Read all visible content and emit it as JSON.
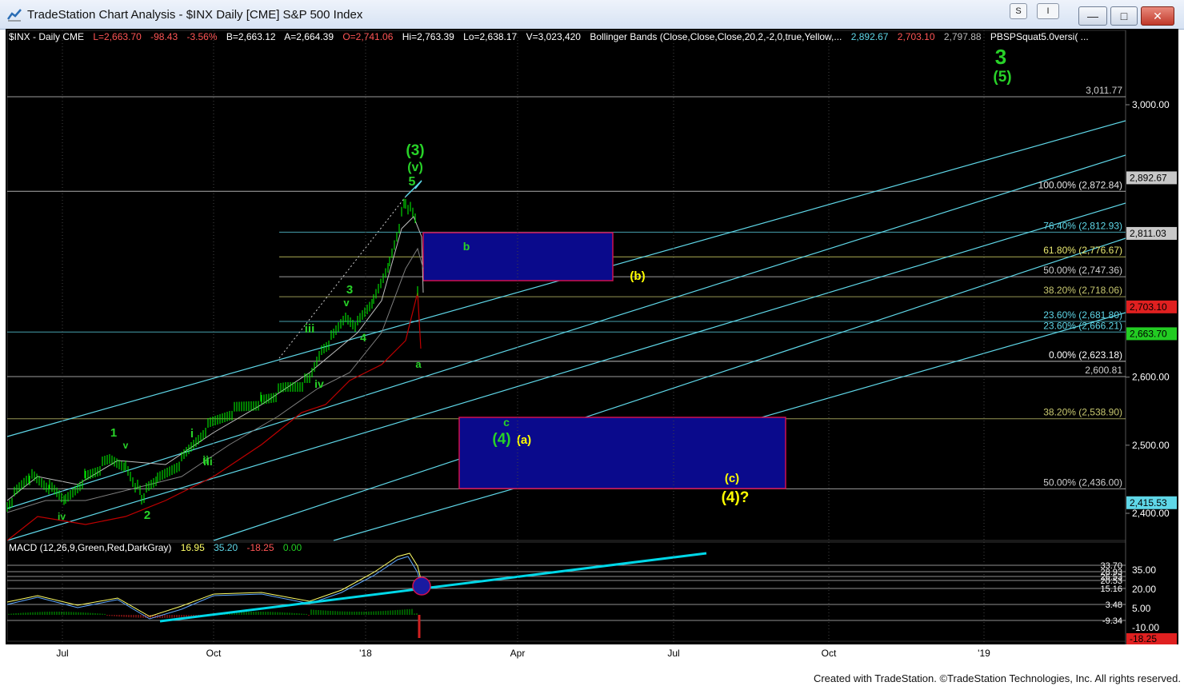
{
  "window": {
    "title": "TradeStation Chart Analysis - $INX Daily [CME] S&P 500 Index",
    "btn_s": "S",
    "btn_i": "I",
    "minimize": "—",
    "maximize": "□",
    "close": "✕"
  },
  "info_bar": {
    "symbol": "$INX - Daily  CME",
    "last": "L=2,663.70",
    "change": "-98.43",
    "pct": "-3.56%",
    "bid": "B=2,663.12",
    "ask": "A=2,664.39",
    "open": "O=2,741.06",
    "high": "Hi=2,763.39",
    "low": "Lo=2,638.17",
    "volume": "V=3,023,420",
    "indicator": "Bollinger Bands (Close,Close,Close,20,2,-2,0,true,Yellow,...",
    "bb_upper": "2,892.67",
    "bb_lower": "2,703.10",
    "bb_mid": "2,797.88",
    "extra": "PBSPSquat5.0versi( ..."
  },
  "colors": {
    "background": "#000000",
    "price_bars": "#00ff00",
    "fib_lines": "#7f7f5f",
    "channel_lines": "#5fd7e8",
    "bb_upper": "#bfbfbf",
    "bb_mid": "#7f7f7f",
    "bb_lower": "#c00000",
    "wave_green": "#28d228",
    "wave_yellow": "#ffff00",
    "box_fill": "#0a0a8c",
    "box_border": "#d01050",
    "macd": "#5fa8ff",
    "signal": "#ffff66",
    "hist_pos": "#00b000",
    "hist_neg": "#d02020",
    "macd_trend": "#00d8e8"
  },
  "price_axis": {
    "ticks": [
      "3,000.00",
      "2,600.00",
      "2,500.00",
      "2,400.00"
    ],
    "badges": [
      {
        "text": "2,892.67",
        "color": "#c8c8c8",
        "value": 2892.67
      },
      {
        "text": "2,811.03",
        "color": "#c8c8c8",
        "value": 2811.03
      },
      {
        "text": "2,703.10",
        "color": "#e02020",
        "value": 2703.1
      },
      {
        "text": "2,663.70",
        "color": "#22cc22",
        "value": 2663.7
      },
      {
        "text": "2,415.53",
        "color": "#5fd7e8",
        "value": 2415.53
      }
    ]
  },
  "levels": [
    {
      "text": "3,011.77",
      "value": 3011.77
    },
    {
      "text": "100.00% (2,872.84)",
      "value": 2872.84
    },
    {
      "text": "76.40% (2,812.93)",
      "value": 2812.93
    },
    {
      "text": "61.80% (2,776.67)",
      "value": 2776.67
    },
    {
      "text": "50.00% (2,747.36)",
      "value": 2747.36
    },
    {
      "text": "38.20% (2,718.06)",
      "value": 2718.06
    },
    {
      "text": "23.60% (2,681.80)",
      "value": 2681.8
    },
    {
      "text": "23.60% (2,666.21)",
      "value": 2666.21
    },
    {
      "text": "0.00% (2,623.18)",
      "value": 2623.18
    },
    {
      "text": "2,600.81",
      "value": 2600.81
    },
    {
      "text": "38.20% (2,538.90)",
      "value": 2538.9
    },
    {
      "text": "50.00% (2,436.00)",
      "value": 2436.0
    }
  ],
  "wave_labels": [
    {
      "text": "3",
      "color": "green"
    },
    {
      "text": "(5)",
      "color": "green"
    },
    {
      "text": "(3)",
      "color": "green"
    },
    {
      "text": "(v)",
      "color": "green"
    },
    {
      "text": "5",
      "color": "green"
    },
    {
      "text": "b",
      "color": "green"
    },
    {
      "text": "(b)",
      "color": "yellow"
    },
    {
      "text": "3",
      "color": "green"
    },
    {
      "text": "v",
      "color": "green"
    },
    {
      "text": "iii",
      "color": "green"
    },
    {
      "text": "4",
      "color": "green"
    },
    {
      "text": "a",
      "color": "green"
    },
    {
      "text": "iv",
      "color": "green"
    },
    {
      "text": "c",
      "color": "green"
    },
    {
      "text": "(4)",
      "color": "green"
    },
    {
      "text": "(a)",
      "color": "yellow"
    },
    {
      "text": "1",
      "color": "green"
    },
    {
      "text": "v",
      "color": "green"
    },
    {
      "text": "i",
      "color": "green"
    },
    {
      "text": "iii",
      "color": "green"
    },
    {
      "text": "ii",
      "color": "green"
    },
    {
      "text": "iv",
      "color": "green"
    },
    {
      "text": "2",
      "color": "green"
    },
    {
      "text": "(c)",
      "color": "yellow"
    },
    {
      "text": "(4)?",
      "color": "yellow"
    }
  ],
  "macd": {
    "label": "MACD (12,26,9,Green,Red,DarkGray)",
    "v1": "16.95",
    "v2": "35.20",
    "v3": "-18.25",
    "v4": "0.00",
    "axis_ticks": [
      "35.00",
      "20.00",
      "5.00",
      "-10.00"
    ],
    "levels": [
      "33.70",
      "28.93",
      "26.53",
      "20.53",
      "15.16",
      "3.48",
      "-9.34"
    ],
    "badge": "-18.25"
  },
  "time_axis": [
    "Jul",
    "Oct",
    "'18",
    "Apr",
    "Jul",
    "Oct",
    "'19"
  ],
  "footer": "Created with TradeStation. ©TradeStation Technologies, Inc. All rights reserved."
}
